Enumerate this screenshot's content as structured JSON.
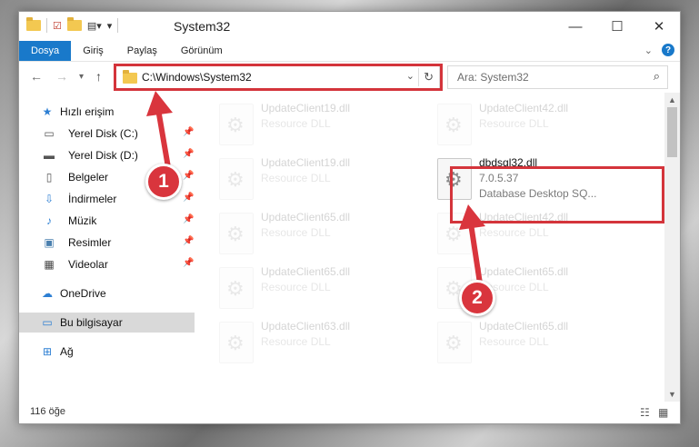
{
  "window": {
    "title": "System32",
    "controls": {
      "minimize": "—",
      "maximize": "☐",
      "close": "✕"
    }
  },
  "ribbon": {
    "tabs": [
      {
        "label": "Dosya",
        "active": true
      },
      {
        "label": "Giriş"
      },
      {
        "label": "Paylaş"
      },
      {
        "label": "Görünüm"
      }
    ]
  },
  "navigation": {
    "address": "C:\\Windows\\System32",
    "search_placeholder": "Ara: System32"
  },
  "nav_pane": {
    "quick_access": "Hızlı erişim",
    "items": [
      {
        "label": "Yerel Disk (C:)",
        "icon": "drive-icon"
      },
      {
        "label": "Yerel Disk (D:)",
        "icon": "drive-icon"
      },
      {
        "label": "Belgeler",
        "icon": "documents-icon"
      },
      {
        "label": "İndirmeler",
        "icon": "downloads-icon"
      },
      {
        "label": "Müzik",
        "icon": "music-icon"
      },
      {
        "label": "Resimler",
        "icon": "pictures-icon"
      },
      {
        "label": "Videolar",
        "icon": "videos-icon"
      }
    ],
    "onedrive": "OneDrive",
    "this_pc": "Bu bilgisayar",
    "network": "Ağ"
  },
  "files": [
    {
      "name": "UpdateClient19.dll",
      "type": "Resource DLL",
      "faded": true
    },
    {
      "name": "UpdateClient42.dll",
      "type": "Resource DLL",
      "faded": true
    },
    {
      "name": "UpdateClient19.dll",
      "type": "Resource DLL",
      "faded": true
    },
    {
      "name": "dbdsql32.dll",
      "version": "7.0.5.37",
      "description": "Database Desktop SQ...",
      "faded": false
    },
    {
      "name": "UpdateClient65.dll",
      "type": "Resource DLL",
      "faded": true
    },
    {
      "name": "UpdateClient42.dll",
      "type": "Resource DLL",
      "faded": true
    },
    {
      "name": "UpdateClient65.dll",
      "type": "Resource DLL",
      "faded": true
    },
    {
      "name": "UpdateClient65.dll",
      "type": "Resource DLL",
      "faded": true
    },
    {
      "name": "UpdateClient63.dll",
      "type": "Resource DLL",
      "faded": true
    },
    {
      "name": "UpdateClient65.dll",
      "type": "Resource DLL",
      "faded": true
    }
  ],
  "status": {
    "count": "116 öğe"
  },
  "annotations": {
    "step1": "1",
    "step2": "2",
    "color": "#d4343b"
  }
}
